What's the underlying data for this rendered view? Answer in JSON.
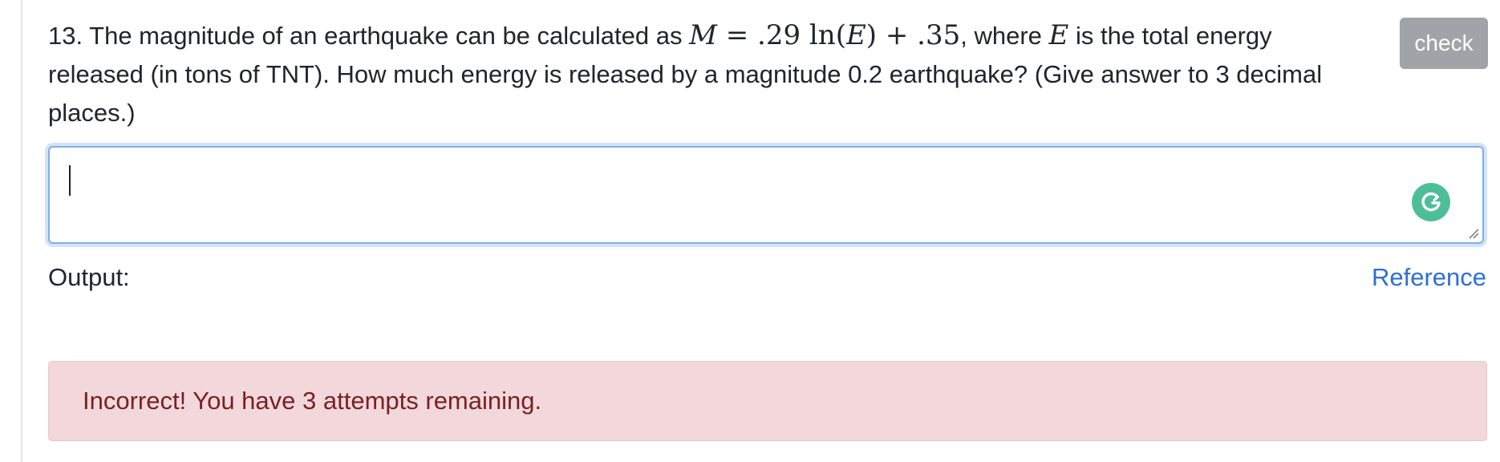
{
  "question": {
    "text_before_formula": "13. The magnitude of an earthquake can be calculated as ",
    "formula": {
      "lhs_var": "M",
      "equals": " = ",
      "coef": ".29",
      "fn": " ln(",
      "arg_var": "E",
      "close": ")",
      "plus": " + ",
      "const": ".35"
    },
    "text_where": ", where ",
    "where_var": "E",
    "text_after": " is the total energy released (in tons of TNT). How much energy is released by a magnitude 0.2 earthquake? (Give answer to 3 decimal places.)"
  },
  "check_button": {
    "label": "check",
    "color": "#a0a4a8"
  },
  "answer": {
    "value": "",
    "focused": true,
    "assistant_icon": "grammarly-icon"
  },
  "output": {
    "label": "Output:",
    "reference_label": "Reference"
  },
  "feedback": {
    "message": "Incorrect! You have 3 attempts remaining.",
    "status": "incorrect",
    "attempts_remaining": 3,
    "background_color": "#f2d8db",
    "text_color": "#7a1f24"
  }
}
